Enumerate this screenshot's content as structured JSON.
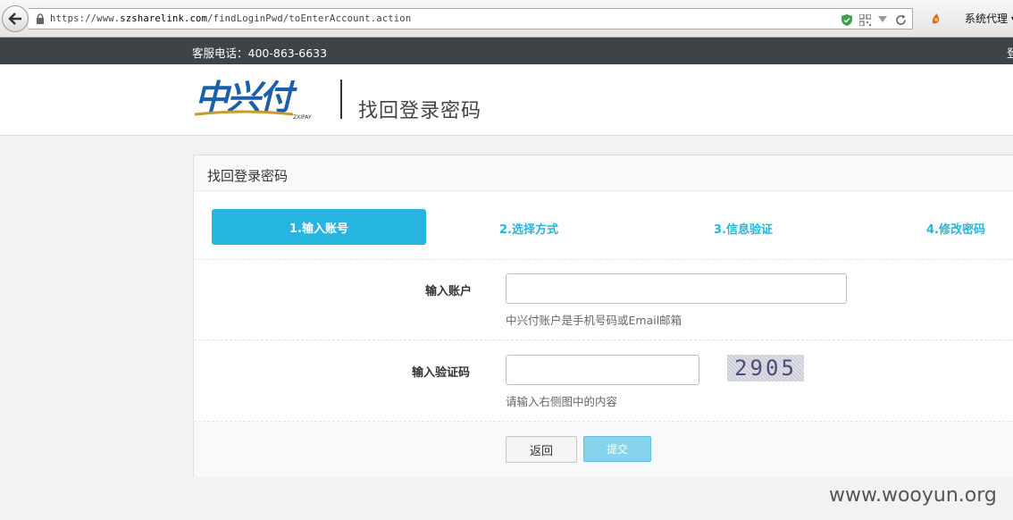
{
  "browser": {
    "url_prefix": "https://www.",
    "url_domain": "szsharelink.com",
    "url_path": "/findLoginPwd/toEnterAccount.action",
    "proxy_menu": "系统代理 ▾",
    "icons": [
      "back-arrow-icon",
      "lock-icon",
      "shield-icon",
      "qr-code-icon",
      "dropdown-icon",
      "refresh-icon",
      "addon-icon"
    ]
  },
  "topbar": {
    "service_phone": "客服电话：400-863-6633",
    "right_text": "登"
  },
  "header": {
    "logo_text": "中兴付",
    "logo_sub": "ZXIPAY",
    "title": "找回登录密码"
  },
  "panel": {
    "title": "找回登录密码",
    "steps": [
      {
        "label": "1.输入账号",
        "active": true
      },
      {
        "label": "2.选择方式",
        "active": false
      },
      {
        "label": "3.信息验证",
        "active": false
      },
      {
        "label": "4.修改密码",
        "active": false
      }
    ],
    "account": {
      "label": "输入账户",
      "value": "",
      "hint": "中兴付账户是手机号码或Email邮箱"
    },
    "captcha": {
      "label": "输入验证码",
      "value": "",
      "image_text": "2905",
      "hint": "请输入右侧图中的内容"
    },
    "buttons": {
      "back": "返回",
      "submit": "提交"
    }
  },
  "colors": {
    "accent": "#26b5de",
    "topbar": "#3d4347",
    "submit_disabled": "#86d3ec",
    "logo_blue": "#1d5ea8",
    "logo_gold": "#c89a2c"
  },
  "watermark": "www.wooyun.org"
}
